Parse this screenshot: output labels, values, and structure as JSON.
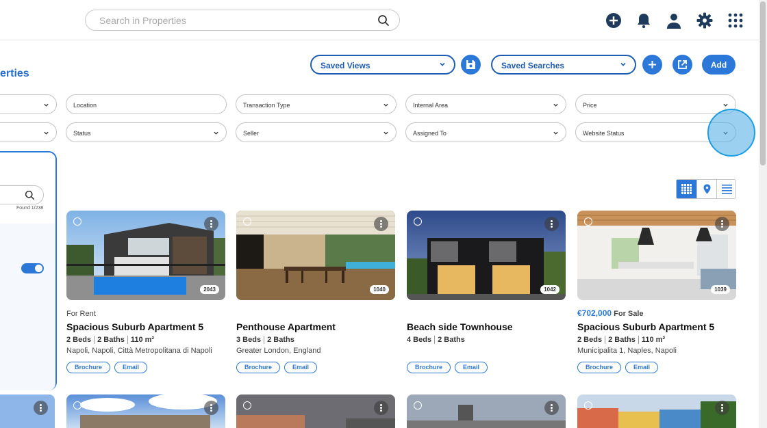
{
  "search": {
    "placeholder": "Search in Properties"
  },
  "header_icons": [
    "add-circle-icon",
    "bell-icon",
    "user-icon",
    "gear-icon",
    "apps-grid-icon"
  ],
  "page": {
    "title": "erties"
  },
  "toolbar": {
    "saved_views_label": "Saved Views",
    "saved_searches_label": "Saved Searches",
    "add_label": "Add"
  },
  "filters": {
    "row1": [
      "Location",
      "Transaction Type",
      "Internal Area",
      "Price"
    ],
    "row2": [
      "Status",
      "Seller",
      "Assigned To",
      "Website Status"
    ]
  },
  "sidebar": {
    "found_text": "Found 1/238"
  },
  "colors": {
    "accent": "#2b78d9",
    "dark_icon": "#1e3a5c"
  },
  "listings": [
    {
      "price": "",
      "type": "For Rent",
      "title": "Spacious Suburb Apartment 5",
      "beds": "2 Beds",
      "baths": "2 Baths",
      "area": "110 m²",
      "location": "Napoli, Napoli, Città Metropolitana di Napoli",
      "image_id": "2043",
      "brochure": "Brochure",
      "email": "Email"
    },
    {
      "price": "",
      "type": "",
      "title": "Penthouse Apartment",
      "beds": "3 Beds",
      "baths": "2 Baths",
      "area": "",
      "location": "Greater London, England",
      "image_id": "1040",
      "brochure": "Brochure",
      "email": "Email"
    },
    {
      "price": "",
      "type": "",
      "title": "Beach side Townhouse",
      "beds": "4 Beds",
      "baths": "2 Baths",
      "area": "",
      "location": "",
      "image_id": "1042",
      "brochure": "Brochure",
      "email": "Email"
    },
    {
      "price": "€702,000",
      "type": "For Sale",
      "title": "Spacious Suburb Apartment 5",
      "beds": "2 Beds",
      "baths": "2 Baths",
      "area": "110 m²",
      "location": "Municipalita 1, Naples, Napoli",
      "image_id": "1039",
      "brochure": "Brochure",
      "email": "Email"
    }
  ]
}
